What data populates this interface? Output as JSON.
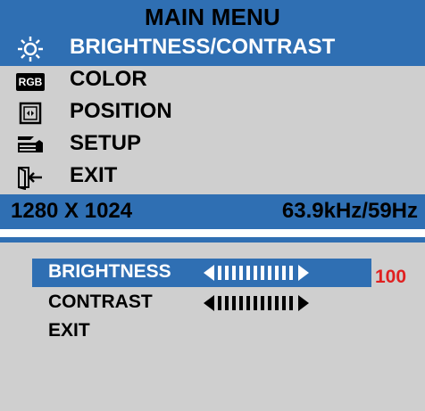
{
  "main_menu": {
    "title": "MAIN MENU",
    "items": [
      {
        "label": "BRIGHTNESS/CONTRAST",
        "icon": "sun-icon",
        "selected": true
      },
      {
        "label": "COLOR",
        "icon": "rgb-icon",
        "selected": false
      },
      {
        "label": "POSITION",
        "icon": "position-icon",
        "selected": false
      },
      {
        "label": "SETUP",
        "icon": "setup-icon",
        "selected": false
      },
      {
        "label": "EXIT",
        "icon": "exit-door-icon",
        "selected": false
      }
    ],
    "resolution": "1280 X 1024",
    "frequency": "63.9kHz/59Hz"
  },
  "submenu": {
    "items": [
      {
        "label": "BRIGHTNESS",
        "selected": true,
        "level": 100
      },
      {
        "label": "CONTRAST",
        "selected": false,
        "level": 100
      },
      {
        "label": "EXIT",
        "selected": false
      }
    ],
    "brightness_value": "100"
  },
  "icons": {
    "rgb_text": "RGB"
  },
  "colors": {
    "accent": "#2f6fb3",
    "panel": "#cfcfcf",
    "value": "#e02020"
  }
}
